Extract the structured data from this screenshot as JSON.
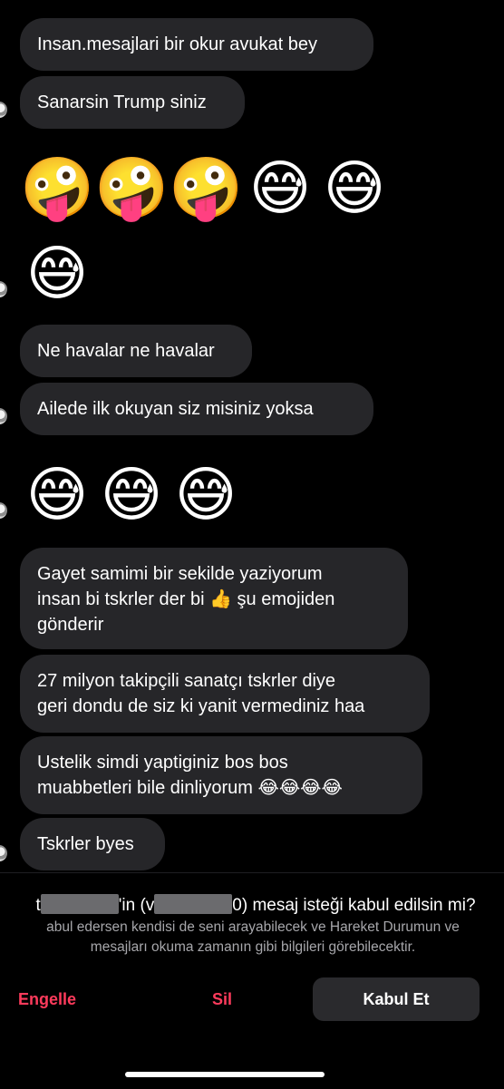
{
  "messages": [
    {
      "type": "text",
      "text": "Insan.mesajlari bir okur avukat bey"
    },
    {
      "type": "text",
      "text": "Sanarsin Trump siniz"
    },
    {
      "type": "emoji",
      "emojis": [
        "🤪",
        "🤪",
        "🤪",
        "😅",
        "😅"
      ]
    },
    {
      "type": "emoji",
      "emojis": [
        "😅"
      ]
    },
    {
      "type": "text",
      "text": "Ne havalar ne havalar"
    },
    {
      "type": "text",
      "text": "Ailede ilk okuyan siz misiniz  yoksa"
    },
    {
      "type": "emoji",
      "emojis": [
        "😅",
        "😅",
        "😅"
      ]
    },
    {
      "type": "text",
      "text": "Gayet samimi bir sekilde yaziyorum\ninsan bi tskrler der bi 👍 şu  emojiden\ngönderir"
    },
    {
      "type": "text",
      "text": "27 milyon takipçili  sanatçı  tskrler diye\ngeri dondu de siz ki yanit vermediniz haa"
    },
    {
      "type": "text",
      "text": "Ustelik simdi yaptiginiz bos bos\nmuabbetleri bile dinliyorum 😂😂😂😂"
    },
    {
      "type": "text",
      "text": "Tskrler byes"
    }
  ],
  "request": {
    "title_prefix": "t",
    "title_mid": "'in (v",
    "title_suffix": "0) mesaj isteği kabul edilsin mi?",
    "subtitle": "abul edersen kendisi de seni arayabilecek ve Hareket Durumun ve\nmesajları okuma zamanın gibi bilgileri görebilecektir."
  },
  "actions": {
    "block_label": "Engelle",
    "delete_label": "Sil",
    "accept_label": "Kabul Et"
  },
  "colors": {
    "background": "#000000",
    "bubble": "#262629",
    "danger": "#ff3b5c",
    "accept_button": "#2a2a2d"
  }
}
